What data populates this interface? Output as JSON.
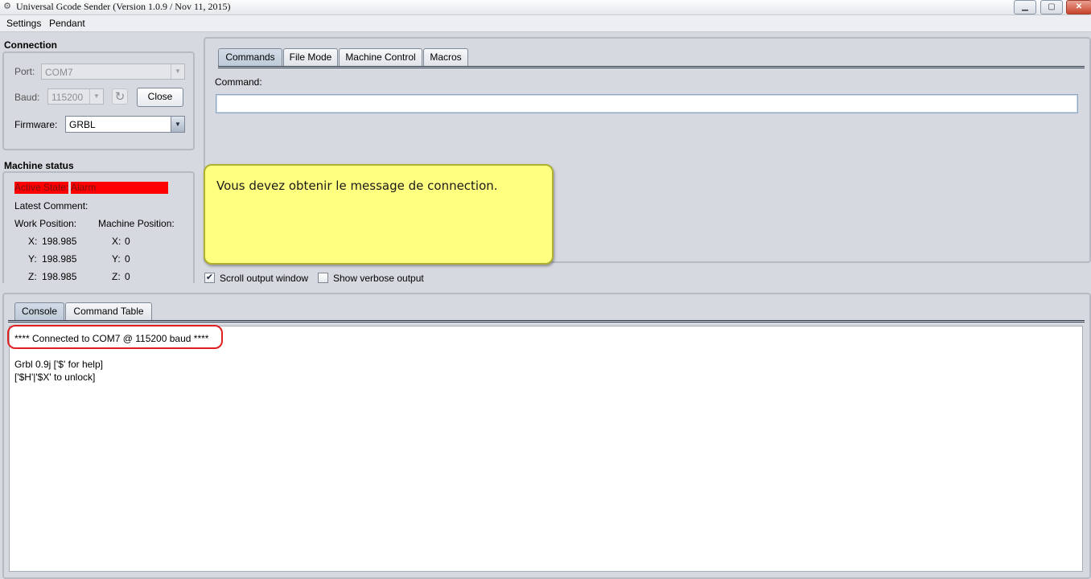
{
  "window": {
    "title": "Universal Gcode Sender (Version 1.0.9 / Nov 11, 2015)",
    "min_glyph": "▁",
    "max_glyph": "▢",
    "close_glyph": "✕"
  },
  "menu": {
    "settings": "Settings",
    "pendant": "Pendant"
  },
  "connection": {
    "title": "Connection",
    "port_label": "Port:",
    "port_value": "COM7",
    "baud_label": "Baud:",
    "baud_value": "115200",
    "refresh_glyph": "↻",
    "close_button": "Close",
    "firmware_label": "Firmware:",
    "firmware_value": "GRBL"
  },
  "machine_status": {
    "title": "Machine status",
    "active_state_label": "Active State:",
    "active_state_value": "Alarm",
    "latest_comment_label": "Latest Comment:",
    "work_position_label": "Work Position:",
    "machine_position_label": "Machine Position:",
    "work": {
      "x_label": "X:",
      "x": "198.985",
      "y_label": "Y:",
      "y": "198.985",
      "z_label": "Z:",
      "z": "198.985"
    },
    "machine": {
      "x_label": "X:",
      "x": "0",
      "y_label": "Y:",
      "y": "0",
      "z_label": "Z:",
      "z": "0"
    },
    "alarm_color": "#ff0000"
  },
  "command_tabs": [
    "Commands",
    "File Mode",
    "Machine Control",
    "Macros"
  ],
  "command": {
    "label": "Command:",
    "value": ""
  },
  "callout": {
    "text": "Vous devez obtenir le message de connection.",
    "color": "#ffff80"
  },
  "options": {
    "scroll_output": "Scroll output window",
    "scroll_checked": true,
    "verbose": "Show verbose output",
    "verbose_checked": false
  },
  "console_tabs": [
    "Console",
    "Command Table"
  ],
  "console": {
    "lines": [
      "**** Connected to COM7 @ 115200 baud ****",
      "",
      "Grbl 0.9j ['$' for help]",
      "['$H'|'$X' to unlock]"
    ],
    "highlight_color": "#e02020"
  }
}
